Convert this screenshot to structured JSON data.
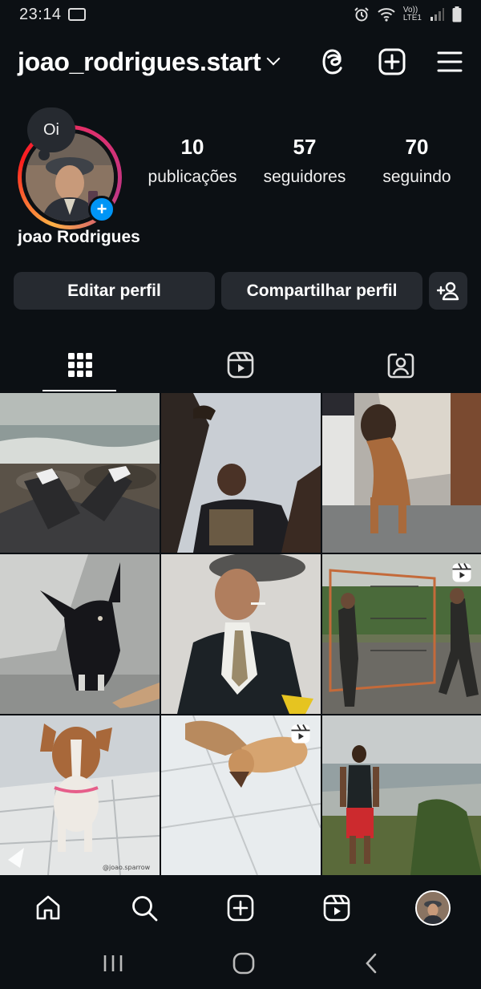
{
  "status_bar": {
    "time": "23:14",
    "signal_label_top": "Vo))",
    "signal_label_bottom": "LTE1"
  },
  "header": {
    "username": "joao_rodrigues.start",
    "icons": [
      "threads-icon",
      "create-post-icon",
      "menu-icon"
    ]
  },
  "profile": {
    "note": "Oi",
    "display_name": "joao Rodrigues",
    "stats": [
      {
        "value": "10",
        "label": "publicações"
      },
      {
        "value": "57",
        "label": "seguidores"
      },
      {
        "value": "70",
        "label": "seguindo"
      }
    ],
    "buttons": {
      "edit": "Editar perfil",
      "share": "Compartilhar perfil"
    }
  },
  "tabs": [
    "grid-icon",
    "reels-icon",
    "tagged-icon"
  ],
  "grid": [
    {
      "subject": "feet on rocks by the sea",
      "reel": false
    },
    {
      "subject": "man looking up at sky",
      "reel": false
    },
    {
      "subject": "brown dog sitting",
      "reel": false
    },
    {
      "subject": "black dog",
      "reel": false
    },
    {
      "subject": "man in suit and flat cap",
      "reel": false
    },
    {
      "subject": "people outdoors near net",
      "reel": true
    },
    {
      "subject": "small brown and white dog",
      "reel": false,
      "watermark": "@joao.sparrow"
    },
    {
      "subject": "dogs on tiled floor",
      "reel": true
    },
    {
      "subject": "man standing by the beach",
      "reel": false
    }
  ],
  "bottom_nav": [
    "home-icon",
    "search-icon",
    "create-icon",
    "reels-icon",
    "profile-avatar"
  ],
  "colors": {
    "background": "#0c1014",
    "button_bg": "#262a30",
    "accent_blue": "#0095f6"
  }
}
